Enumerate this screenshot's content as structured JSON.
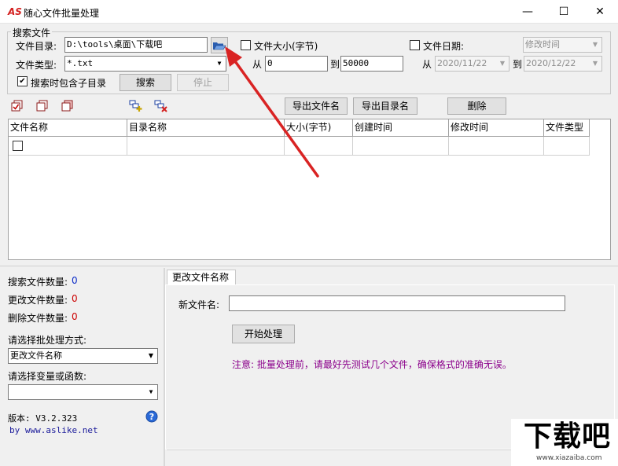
{
  "window": {
    "logo": "AS",
    "title": "随心文件批量处理",
    "minimize": "—",
    "maximize": "☐",
    "close": "✕"
  },
  "search_group": {
    "legend": "搜索文件",
    "dir_label": "文件目录:",
    "dir_value": "D:\\tools\\桌面\\下载吧",
    "type_label": "文件类型:",
    "type_value": "*.txt",
    "include_sub_label": "搜索时包含子目录",
    "include_sub_checked": true,
    "search_button": "搜索",
    "stop_button": "停止",
    "size_label": "文件大小(字节)",
    "size_from_label": "从",
    "size_from": "0",
    "size_to_label": "到",
    "size_to": "50000",
    "date_label": "文件日期:",
    "date_mode": "修改时间",
    "date_from_label": "从",
    "date_from": "2020/11/22",
    "date_to_label": "到",
    "date_to": "2020/12/22"
  },
  "toolbar": {
    "export_filenames": "导出文件名",
    "export_dirnames": "导出目录名",
    "delete": "删除"
  },
  "table": {
    "columns": [
      "文件名称",
      "目录名称",
      "大小(字节)",
      "创建时间",
      "修改时间",
      "文件类型"
    ]
  },
  "stats": {
    "searched_label": "搜索文件数量:",
    "searched_value": "0",
    "renamed_label": "更改文件数量:",
    "renamed_value": "0",
    "deleted_label": "删除文件数量:",
    "deleted_value": "0"
  },
  "mode": {
    "label": "请选择批处理方式:",
    "value": "更改文件名称"
  },
  "variable": {
    "label": "请选择变量或函数:",
    "value": ""
  },
  "about": {
    "version": "版本: V3.2.323",
    "site": "by www.aslike.net"
  },
  "rename_tab": {
    "tab_label": "更改文件名称",
    "new_name_label": "新文件名:",
    "new_name_value": "",
    "start_button": "开始处理",
    "note": "注意: 批量处理前，请最好先测试几个文件，确保格式的准确无误。"
  },
  "watermark": {
    "text": "下载吧",
    "site": "www.xiazaiba.com"
  },
  "colors": {
    "accent_red": "#d4201f",
    "note_purple": "#8b008b",
    "stat_blue": "#0a2bc9",
    "stat_red": "#cc0000"
  }
}
